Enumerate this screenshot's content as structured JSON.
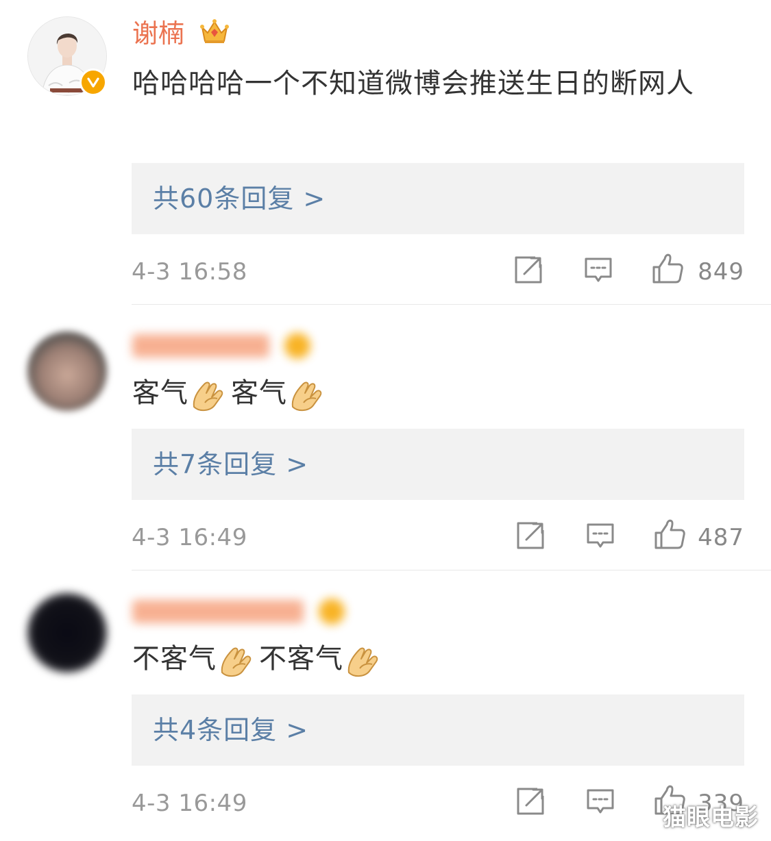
{
  "comments": [
    {
      "username": "谢楠",
      "text": "哈哈哈哈一个不知道微博会推送生日的断网人",
      "replies": "共60条回复 >",
      "timestamp": "4-3 16:58",
      "likes": "849"
    },
    {
      "username": "",
      "text_a": "客气",
      "text_b": "客气",
      "replies": "共7条回复 >",
      "timestamp": "4-3 16:49",
      "likes": "487"
    },
    {
      "username": "",
      "text_a": "不客气",
      "text_b": "不客气",
      "replies": "共4条回复 >",
      "timestamp": "4-3 16:49",
      "likes": "339"
    }
  ],
  "watermark": "猫眼电影",
  "colors": {
    "username_orange": "#eb7350",
    "reply_link": "#5b7fa6",
    "reply_bg": "#f2f2f2",
    "meta_gray": "#999999",
    "verified_badge": "#f7a600"
  },
  "icons": [
    "crown-icon",
    "verified-icon",
    "share-icon",
    "comment-icon",
    "like-icon",
    "gesture-emoji-icon"
  ]
}
